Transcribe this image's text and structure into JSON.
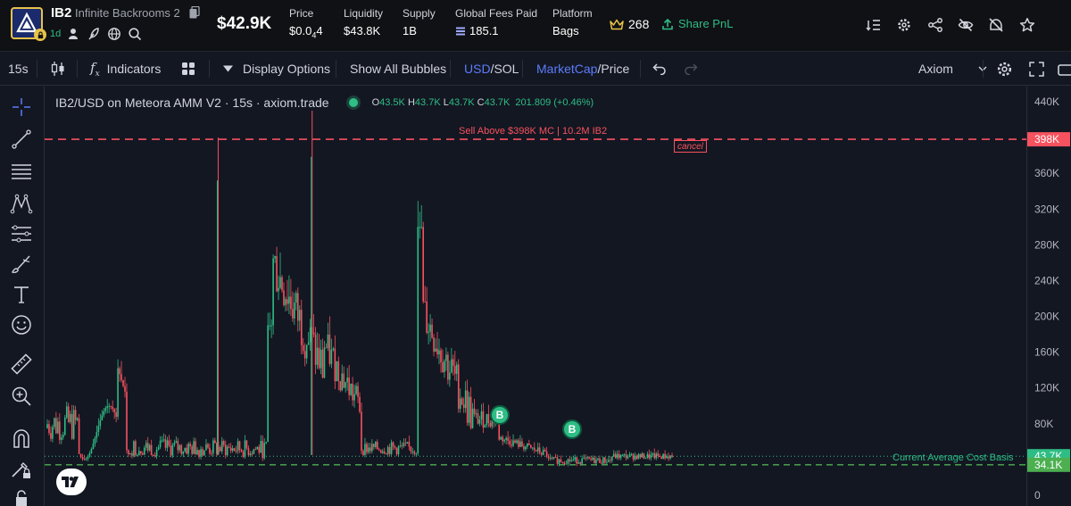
{
  "header": {
    "symbol": "IB2",
    "name": "Infinite Backrooms 2",
    "age": "1d",
    "market_cap": "$42.9K",
    "stats": [
      {
        "label": "Price",
        "value_prefix": "$0.0",
        "value_sub": "4",
        "value_suffix": "4"
      },
      {
        "label": "Liquidity",
        "value": "$43.8K"
      },
      {
        "label": "Supply",
        "value": "1B"
      },
      {
        "label": "Global Fees Paid",
        "value": "185.1"
      },
      {
        "label": "Platform",
        "value": "Bags"
      }
    ],
    "holders": "268",
    "share_pnl": "Share PnL",
    "colors": {
      "accent_green": "#2ebd85",
      "accent_red": "#f7525f",
      "gold": "#e8c24a"
    }
  },
  "toolbar": {
    "interval": "15s",
    "indicators": "Indicators",
    "display_options": "Display Options",
    "show_all_bubbles": "Show All Bubbles",
    "usd": "USD",
    "sol": "/SOL",
    "marketcap": "MarketCap",
    "price": "/Price",
    "layout_name": "Axiom"
  },
  "legend": {
    "title": "IB2/USD on Meteora AMM V2 · 15s · axiom.trade",
    "o": "43.5K",
    "h": "43.7K",
    "l": "43.7K",
    "c": "43.7K",
    "change": "201.809 (+0.46%)"
  },
  "order": {
    "sell_text": "Sell Above $398K MC | 10.2M IB2",
    "cancel": "cancel",
    "level_label": "398K"
  },
  "avg_cost": {
    "text": "Current Average Cost Basis",
    "level_label": "34.1K"
  },
  "last_price_label": "43.7K",
  "bubbles": [
    "B",
    "B"
  ],
  "axis_ticks": [
    "440K",
    "400K",
    "360K",
    "320K",
    "280K",
    "240K",
    "200K",
    "160K",
    "120K",
    "80K",
    "40K",
    "0"
  ],
  "chart_data": {
    "type": "candlestick",
    "ylim": [
      0,
      450000
    ],
    "y_tick_values": [
      440000,
      400000,
      360000,
      320000,
      280000,
      240000,
      200000,
      160000,
      120000,
      80000,
      40000,
      0
    ],
    "horizontal_lines": [
      {
        "value": 398000,
        "label": "398K",
        "style": "dashed",
        "color": "#f7525f"
      },
      {
        "value": 43700,
        "label": "43.7K",
        "style": "dotted",
        "color": "#2ebd85"
      },
      {
        "value": 34100,
        "label": "34.1K",
        "style": "dashed",
        "color": "#4caf50"
      }
    ],
    "peaks": [
      {
        "x_index": 0.23,
        "value": 400000
      },
      {
        "x_index": 0.38,
        "value": 430000
      }
    ],
    "last_value": 43700
  }
}
